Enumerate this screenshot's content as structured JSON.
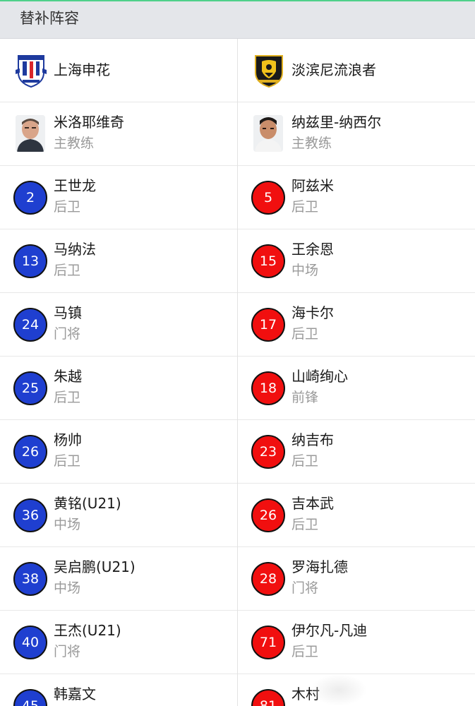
{
  "header": {
    "title": "替补阵容"
  },
  "teams": {
    "home": {
      "name": "上海申花",
      "logo_icon": "shanghai-shenhua-crest-icon",
      "color": "#1f3fd0"
    },
    "away": {
      "name": "淡滨尼流浪者",
      "logo_icon": "tampines-rovers-crest-icon",
      "color": "#f10f0f"
    }
  },
  "coaches": {
    "home": {
      "name": "米洛耶维奇",
      "role": "主教练"
    },
    "away": {
      "name": "纳兹里-纳西尔",
      "role": "主教练"
    }
  },
  "home_subs": [
    {
      "number": "2",
      "name": "王世龙",
      "position": "后卫"
    },
    {
      "number": "13",
      "name": "马纳法",
      "position": "后卫"
    },
    {
      "number": "24",
      "name": "马镇",
      "position": "门将"
    },
    {
      "number": "25",
      "name": "朱越",
      "position": "后卫"
    },
    {
      "number": "26",
      "name": "杨帅",
      "position": "后卫"
    },
    {
      "number": "36",
      "name": "黄铭(U21)",
      "position": "中场"
    },
    {
      "number": "38",
      "name": "吴启鹏(U21)",
      "position": "中场"
    },
    {
      "number": "40",
      "name": "王杰(U21)",
      "position": "门将"
    },
    {
      "number": "45",
      "name": "韩嘉文",
      "position": ""
    }
  ],
  "away_subs": [
    {
      "number": "5",
      "name": "阿兹米",
      "position": "后卫"
    },
    {
      "number": "15",
      "name": "王余恩",
      "position": "中场"
    },
    {
      "number": "17",
      "name": "海卡尔",
      "position": "后卫"
    },
    {
      "number": "18",
      "name": "山崎绚心",
      "position": "前锋"
    },
    {
      "number": "23",
      "name": "纳吉布",
      "position": "后卫"
    },
    {
      "number": "26",
      "name": "吉本武",
      "position": "后卫"
    },
    {
      "number": "28",
      "name": "罗海扎德",
      "position": "门将"
    },
    {
      "number": "71",
      "name": "伊尔凡-凡迪",
      "position": "后卫"
    },
    {
      "number": "81",
      "name": "木村",
      "position": ""
    }
  ]
}
